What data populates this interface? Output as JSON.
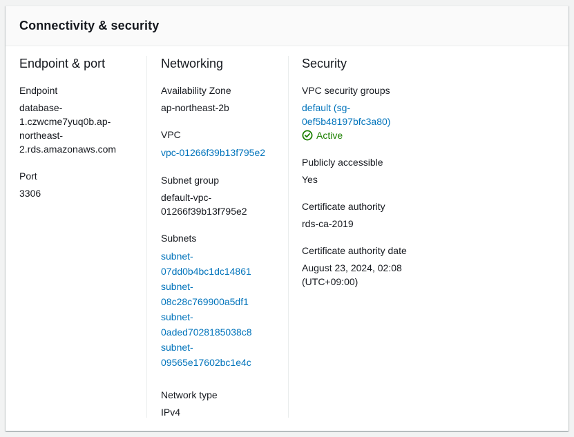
{
  "panel": {
    "title": "Connectivity & security"
  },
  "endpoint_port": {
    "heading": "Endpoint & port",
    "endpoint_label": "Endpoint",
    "endpoint_value": "database-1.czwcme7yuq0b.ap-northeast-2.rds.amazonaws.com",
    "endpoint_lines": [
      "database-",
      "1.czwcme7yuq0b.ap-",
      "northeast-",
      "2.rds.amazonaws.com"
    ],
    "port_label": "Port",
    "port_value": "3306"
  },
  "networking": {
    "heading": "Networking",
    "az_label": "Availability Zone",
    "az_value": "ap-northeast-2b",
    "vpc_label": "VPC",
    "vpc_value": "vpc-01266f39b13f795e2",
    "subnet_group_label": "Subnet group",
    "subnet_group_lines": [
      "default-vpc-",
      "01266f39b13f795e2"
    ],
    "subnets_label": "Subnets",
    "subnets": [
      {
        "line1": "subnet-",
        "line2": "07dd0b4bc1dc14861"
      },
      {
        "line1": "subnet-",
        "line2": "08c28c769900a5df1"
      },
      {
        "line1": "subnet-",
        "line2": "0aded7028185038c8"
      },
      {
        "line1": "subnet-",
        "line2": "09565e17602bc1e4c"
      }
    ],
    "network_type_label": "Network type",
    "network_type_value": "IPv4"
  },
  "security": {
    "heading": "Security",
    "sg_label": "VPC security groups",
    "sg_lines": [
      "default (sg-",
      "0ef5b48197bfc3a80)"
    ],
    "sg_status": "Active",
    "sg_status_icon": "check-circle-icon",
    "public_label": "Publicly accessible",
    "public_value": "Yes",
    "ca_label": "Certificate authority",
    "ca_value": "rds-ca-2019",
    "ca_date_label": "Certificate authority date",
    "ca_date_lines": [
      "August 23, 2024, 02:08",
      "(UTC+09:00)"
    ]
  },
  "colors": {
    "link": "#0073bb",
    "success": "#1d8102",
    "text": "#16191f",
    "header_bg": "#fafafa"
  }
}
